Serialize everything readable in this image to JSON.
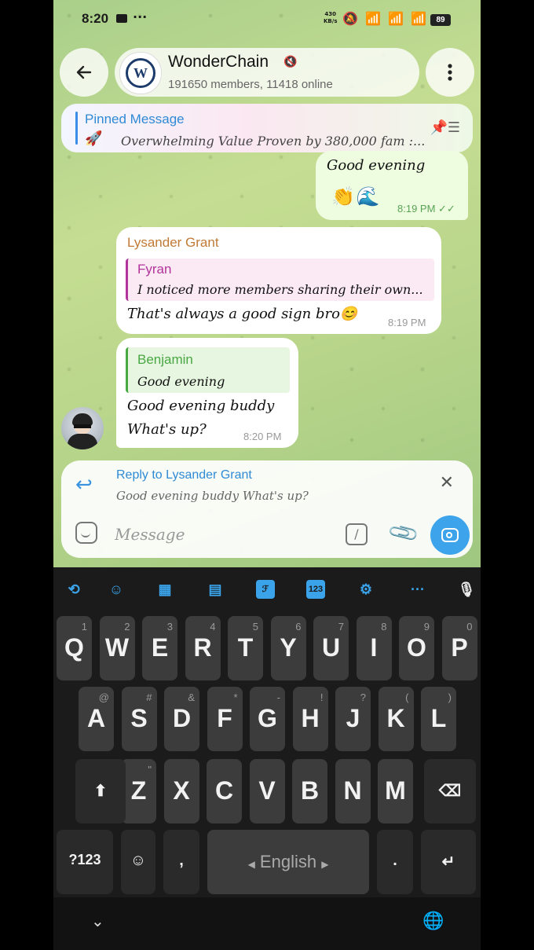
{
  "status": {
    "time": "8:20",
    "dots": "···",
    "speed_value": "430",
    "speed_unit": "KB/s",
    "battery": "89"
  },
  "header": {
    "title": "WonderChain",
    "avatar_letter": "W",
    "subtitle": "191650 members, 11418 online"
  },
  "pinned": {
    "title": "Pinned Message",
    "text": "Overwhelming Value Proven by 380,000 fam :..."
  },
  "messages": [
    {
      "text": "Good evening",
      "time": "8:19 PM",
      "direction": "outgoing"
    },
    {
      "sender": "Lysander Grant",
      "quote_name": "Fyran",
      "quote_text": "I noticed more members sharing their own...",
      "text": "That's always a good sign bro😊",
      "time": "8:19 PM"
    },
    {
      "quote_name": "Benjamin",
      "quote_text": "Good evening",
      "line1": "Good evening buddy",
      "line2": "What's up?",
      "time": "8:20 PM"
    }
  ],
  "composer": {
    "reply_title": "Reply to Lysander Grant",
    "reply_text": "Good evening buddy  What's up?",
    "placeholder": "Message",
    "value": ""
  },
  "keyboard": {
    "toolbar_labels": {
      "numpad": "123"
    },
    "row1": [
      {
        "key": "Q",
        "hint": "1"
      },
      {
        "key": "W",
        "hint": "2"
      },
      {
        "key": "E",
        "hint": "3"
      },
      {
        "key": "R",
        "hint": "4"
      },
      {
        "key": "T",
        "hint": "5"
      },
      {
        "key": "Y",
        "hint": "6"
      },
      {
        "key": "U",
        "hint": "7"
      },
      {
        "key": "I",
        "hint": "8"
      },
      {
        "key": "O",
        "hint": "9"
      },
      {
        "key": "P",
        "hint": "0"
      }
    ],
    "row2": [
      {
        "key": "A",
        "hint": "@"
      },
      {
        "key": "S",
        "hint": "#"
      },
      {
        "key": "D",
        "hint": "&"
      },
      {
        "key": "F",
        "hint": "*"
      },
      {
        "key": "G",
        "hint": "-"
      },
      {
        "key": "H",
        "hint": "!"
      },
      {
        "key": "J",
        "hint": "?"
      },
      {
        "key": "K",
        "hint": "("
      },
      {
        "key": "L",
        "hint": ")"
      }
    ],
    "row3": [
      {
        "key": "Z",
        "hint": "\""
      },
      {
        "key": "X",
        "hint": ""
      },
      {
        "key": "C",
        "hint": ""
      },
      {
        "key": "V",
        "hint": ""
      },
      {
        "key": "B",
        "hint": ""
      },
      {
        "key": "N",
        "hint": ""
      },
      {
        "key": "M",
        "hint": ""
      }
    ],
    "symbols_key": "?123",
    "comma_key": ",",
    "space_label": "English",
    "period_key": "."
  }
}
